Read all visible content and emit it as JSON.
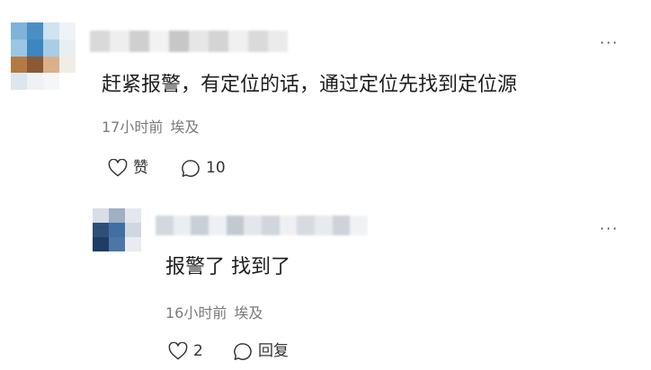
{
  "comment": {
    "text": "赶紧报警，有定位的话，通过定位先找到定位源",
    "time": "17小时前",
    "location": "埃及",
    "like_label": "赞",
    "reply_count": "10",
    "more_label": "···"
  },
  "reply": {
    "text": "报警了 找到了",
    "time": "16小时前",
    "location": "埃及",
    "like_count": "2",
    "reply_label": "回复",
    "more_label": "···"
  },
  "colors": {
    "avatar1": [
      "#7fb3d9",
      "#4a8fc4",
      "#cfe3f0",
      "#eef3f7",
      "#9cc6e3",
      "#3d86c0",
      "#a9cde6",
      "#e9eef1",
      "#b47a45",
      "#8a5a33",
      "#d9b08a",
      "#f1ece6",
      "#dde6ee",
      "#eef2f5",
      "#f4f6f8",
      "#ffffff"
    ],
    "avatar2": [
      "#d7dee6",
      "#9fb0c2",
      "#e4e8ee",
      "#2f4f78",
      "#3f6fa3",
      "#cfd7e2",
      "#1f3c64",
      "#4b76a6",
      "#e8ecf1"
    ],
    "blur1": [
      "#d9d9d9",
      "#eeeeee",
      "#cfcfcf",
      "#f2f2f2",
      "#c7c7c7",
      "#e6e6e6",
      "#d4d4d4",
      "#f0f0f0",
      "#dadada",
      "#ebebeb"
    ],
    "blur2": [
      "#d2d8de",
      "#ebeef1",
      "#c9cfd6",
      "#eef1f4",
      "#c2c9d1",
      "#e3e7eb",
      "#d0d6dc",
      "#eef0f2",
      "#d6dbe0",
      "#e8ebee",
      "#cdd3d9",
      "#f0f2f4"
    ]
  }
}
